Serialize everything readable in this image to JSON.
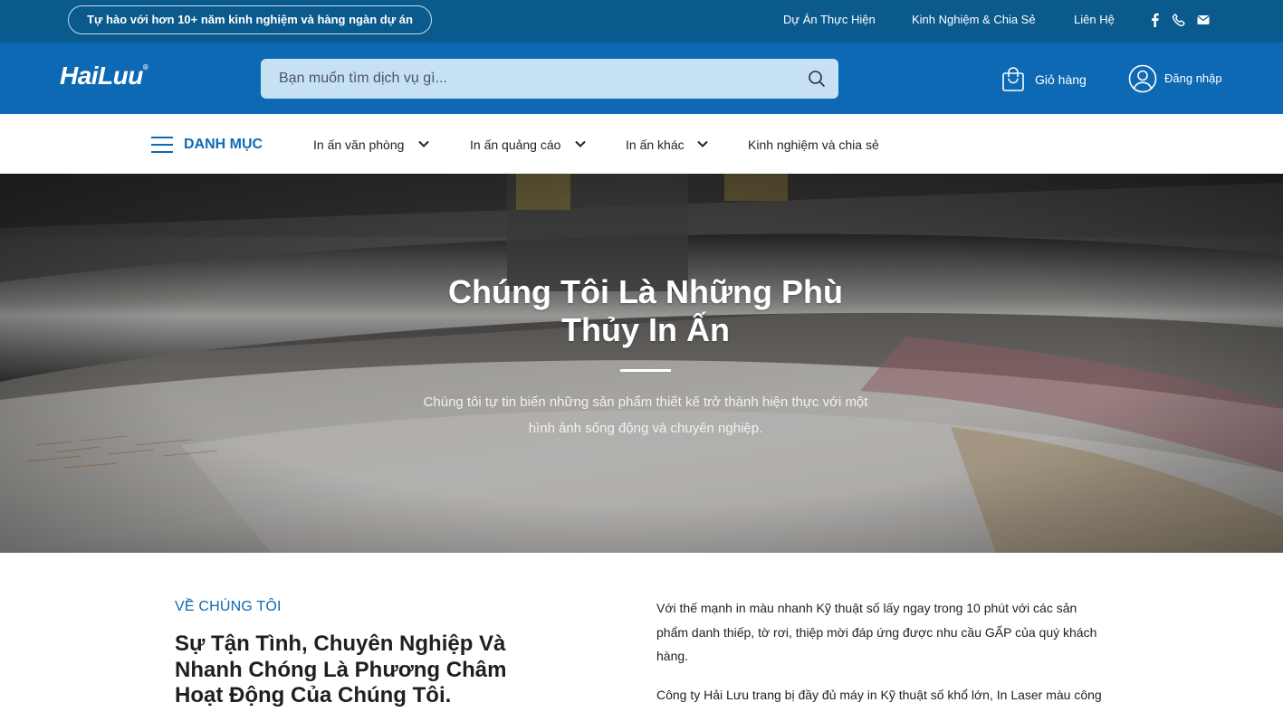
{
  "topbar": {
    "tagline": "Tự hào với hơn 10+ năm kinh nghiệm và hàng ngàn dự án",
    "links": [
      "Dự Án Thực Hiện",
      "Kinh Nghiệm & Chia Sẻ",
      "Liên Hệ"
    ],
    "social_icons": [
      "facebook-icon",
      "phone-icon",
      "mail-icon"
    ]
  },
  "header": {
    "logo": "HaiLuu",
    "logo_mark": "®",
    "search_placeholder": "Bạn muốn tìm dịch vụ gì...",
    "cart_label": "Giỏ hàng",
    "login_label": "Đăng nhập"
  },
  "nav": {
    "menu_label": "DANH MỤC",
    "items": [
      {
        "label": "In ấn văn phòng",
        "dropdown": true
      },
      {
        "label": "In ấn quảng cáo",
        "dropdown": true
      },
      {
        "label": "In ấn khác",
        "dropdown": true
      },
      {
        "label": "Kinh nghiệm và chia sẻ",
        "dropdown": false
      }
    ]
  },
  "hero": {
    "title_line1": "Chúng Tôi Là Những Phù",
    "title_line2": "Thủy In Ấn",
    "subtitle_line1": "Chúng tôi tự tin biến những sản phẩm thiết kế trở thành hiện thực với một",
    "subtitle_line2": "hình ảnh sống động và chuyên nghiệp."
  },
  "about": {
    "kicker": "VỀ CHÚNG TÔI",
    "title_line1": "Sự Tận Tình, Chuyên Nghiệp Và",
    "title_line2": "Nhanh Chóng Là Phương Châm",
    "title_line3": "Hoạt Động Của Chúng Tôi.",
    "p1_line1": "Với thế mạnh in màu nhanh Kỹ thuật số lấy ngay trong 10 phút với các sản",
    "p1_line2": "phẩm danh thiếp, tờ rơi, thiệp mời đáp ứng được nhu cầu GẤP của quý khách",
    "p1_line3": "hàng.",
    "p2_line1": "Công ty Hải Lưu trang bị đầy đủ máy in Kỹ thuật số khổ lớn, In Laser màu công"
  },
  "colors": {
    "topbar": "#0b5a8e",
    "header": "#0d69b3",
    "search_bg": "#c7e1f4",
    "accent": "#0d69b3"
  }
}
